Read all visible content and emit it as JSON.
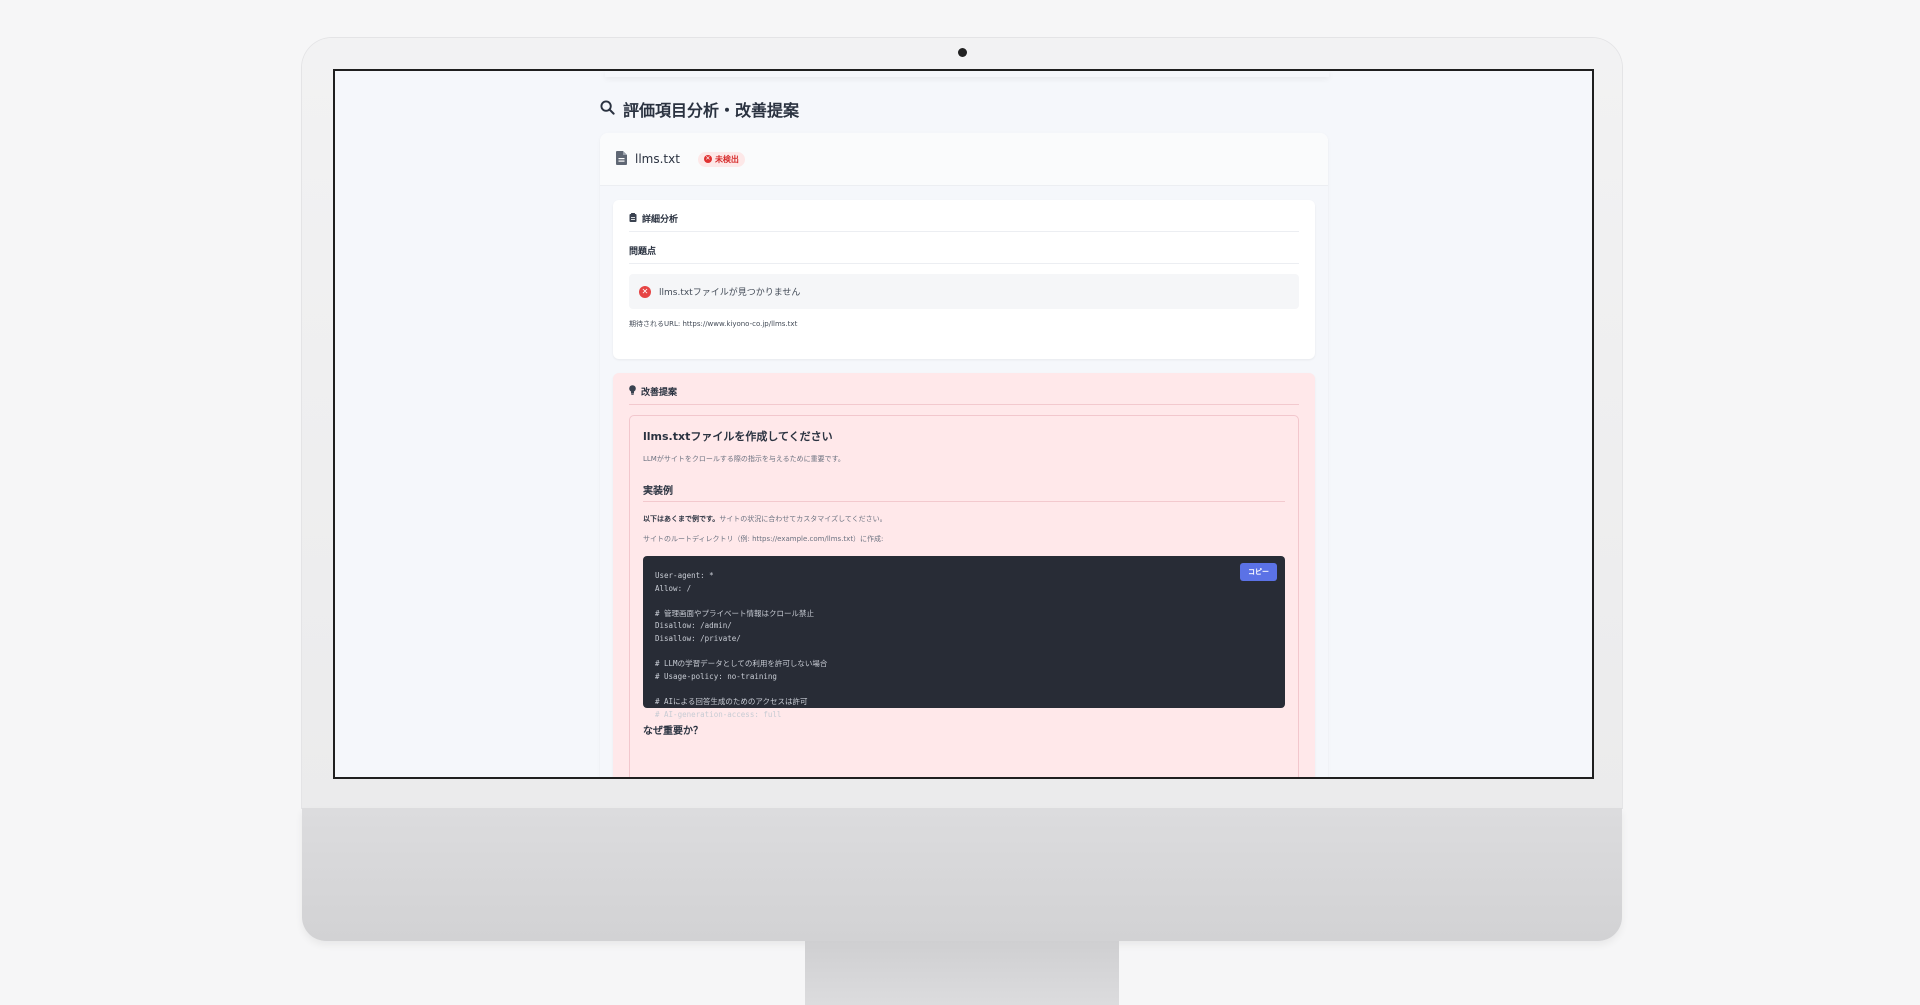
{
  "page": {
    "heading": "評価項目分析・改善提案"
  },
  "file_card": {
    "file_name": "llms.txt",
    "status_badge": "未検出"
  },
  "analysis": {
    "title": "詳細分析",
    "subtitle": "問題点",
    "issue_text": "llms.txtファイルが見つかりません",
    "expected_url_label": "期待されるURL: https://www.kiyono-co.jp/llms.txt"
  },
  "proposal": {
    "title": "改善提案",
    "item_title": "llms.txtファイルを作成してください",
    "item_desc": "LLMがサイトをクロールする際の指示を与えるために重要です。",
    "example_heading": "実装例",
    "note_bold": "以下はあくまで例です。",
    "note_rest": "サイトの状況に合わせてカスタマイズしてください。",
    "note2": "サイトのルートディレクトリ（例: https://example.com/llms.txt）に作成:",
    "copy_label": "コピー",
    "code": "User-agent: *\nAllow: /\n\n# 管理画面やプライベート情報はクロール禁止\nDisallow: /admin/\nDisallow: /private/\n\n# LLMの学習データとしての利用を許可しない場合\n# Usage-policy: no-training\n\n# AIによる回答生成のためのアクセスは許可\n# AI-generation-access: full",
    "why_heading": "なぜ重要か？"
  },
  "icons": {
    "heading_icon": "search-icon",
    "file_icon": "file-icon",
    "badge_icon": "x-circle-icon",
    "analysis_icon": "clipboard-icon",
    "issue_icon": "x-circle-icon",
    "proposal_icon": "lightbulb-icon"
  },
  "colors": {
    "accent": "#5b72e6",
    "error": "#e03131",
    "proposal_bg": "#ffe8ea",
    "code_bg": "#282c36"
  }
}
